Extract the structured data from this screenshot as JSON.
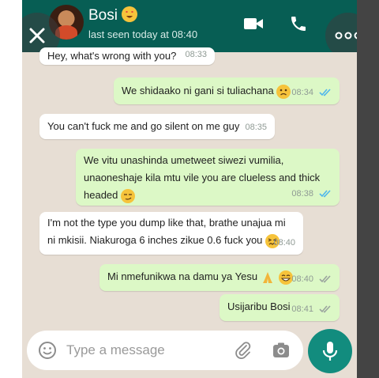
{
  "header": {
    "contact_name": "Bosi",
    "last_seen": "last seen today at 08:40"
  },
  "messages": [
    {
      "dir": "in",
      "text": "Hey, what's wrong with you?",
      "time": "08:33",
      "emoji": ""
    },
    {
      "dir": "out",
      "text": "We shidaako ni gani si tuliachana",
      "time": "08:34",
      "emoji": "slightly-frowning-face",
      "ticks": "read"
    },
    {
      "dir": "in",
      "text": "You can't fuck me and go silent on me guy",
      "time": "08:35",
      "emoji": ""
    },
    {
      "dir": "out",
      "text": "We vitu unashinda umetweet siwezi vumilia, unaoneshaje kila mtu vile you are clueless and thick headed",
      "time": "08:38",
      "emoji": "smirking-face",
      "ticks": "read"
    },
    {
      "dir": "in",
      "text": "I'm not the type you dump like that, brathe unajua mi ni mkisii. Niakuroga 6 inches zikue 0.6 fuck you",
      "time": "08:40",
      "emoji": "persevering-face"
    },
    {
      "dir": "out",
      "text": "Mi nmefunikwa na damu ya Yesu",
      "time": "08:40",
      "emoji": "folded-hands grinning-face",
      "ticks": "delivered"
    },
    {
      "dir": "out",
      "text": "Usijaribu Bosi",
      "time": "08:41",
      "emoji": "",
      "ticks": "delivered"
    }
  ],
  "composer": {
    "placeholder": "Type a message"
  },
  "icons": {
    "video": "video-call-icon",
    "call": "phone-call-icon",
    "menu": "more-options-icon",
    "close": "close-icon",
    "emoji": "emoji-icon",
    "attach": "attach-icon",
    "camera": "camera-icon",
    "mic": "mic-icon"
  },
  "colors": {
    "header": "#075e54",
    "outgoing_bubble": "#dcf8c6",
    "incoming_bubble": "#ffffff",
    "chat_bg": "#e7ded4",
    "read_ticks": "#4fb6ec",
    "mic_button": "#128c7e"
  }
}
